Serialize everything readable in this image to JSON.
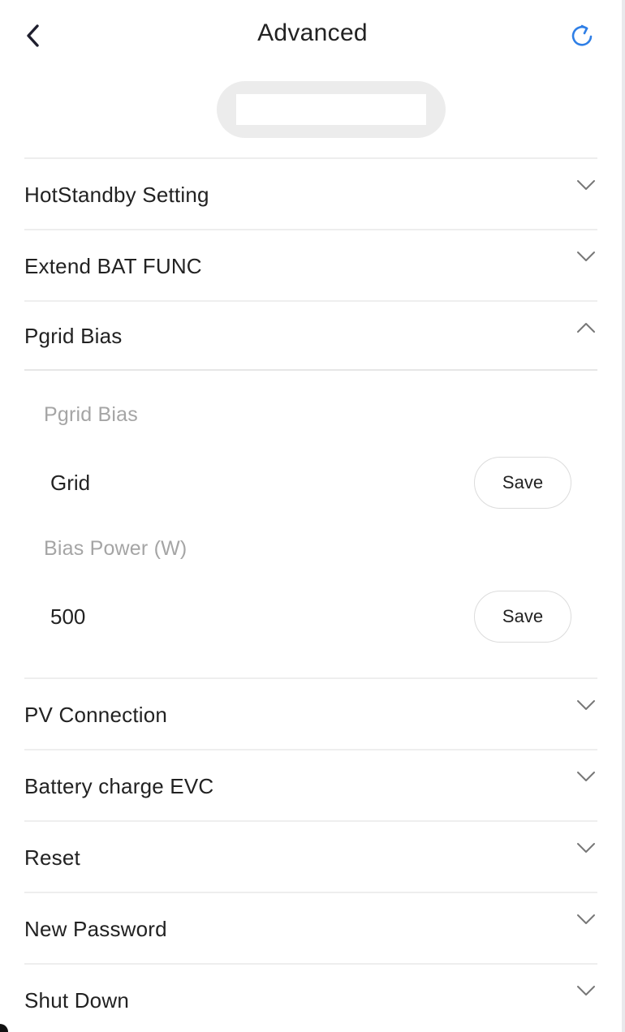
{
  "header": {
    "title": "Advanced",
    "back_icon": "chevron-left-icon",
    "refresh_icon": "refresh-icon",
    "accent_color": "#2f7fe6"
  },
  "sections_top": [
    {
      "label": "HotStandby Setting"
    },
    {
      "label": "Extend BAT FUNC"
    }
  ],
  "expanded": {
    "label": "Pgrid Bias",
    "fields": {
      "pgrid_label": "Pgrid Bias",
      "pgrid_value": "Grid",
      "bias_label": "Bias Power (W)",
      "bias_value": "500",
      "save_label": "Save"
    }
  },
  "sections_bottom": [
    {
      "label": "PV Connection"
    },
    {
      "label": "Battery charge EVC"
    },
    {
      "label": "Reset"
    },
    {
      "label": "New Password"
    },
    {
      "label": "Shut Down"
    }
  ]
}
